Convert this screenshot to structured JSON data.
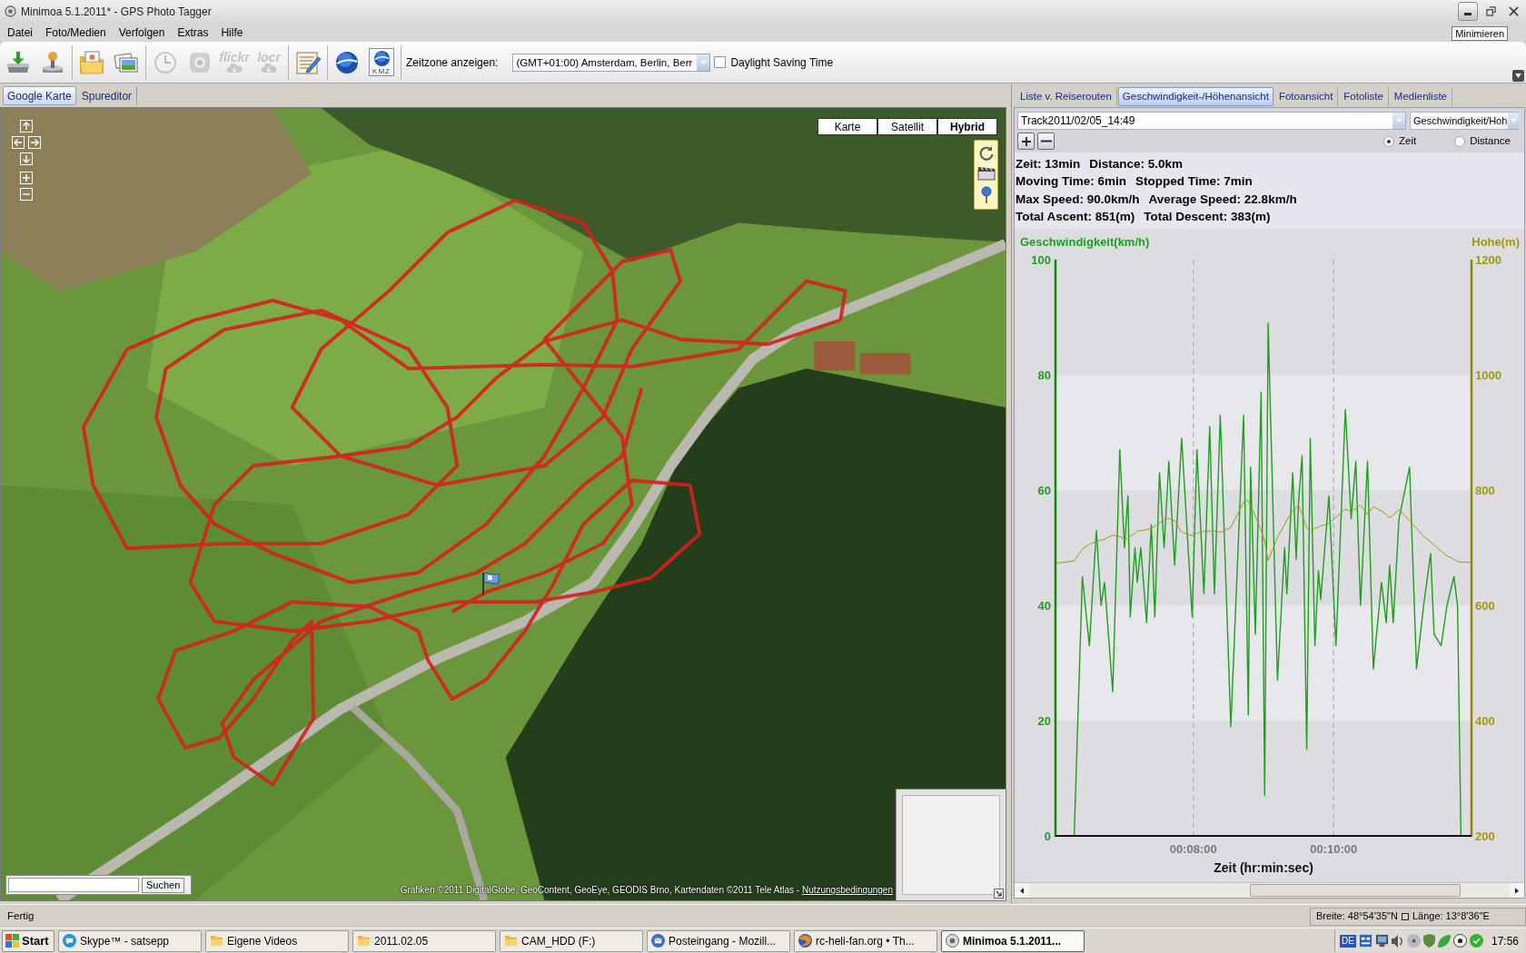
{
  "window": {
    "title": "Minimoa 5.1.2011* - GPS Photo Tagger",
    "controls": [
      {
        "kind": "minimize",
        "hovered": true
      },
      {
        "kind": "restore",
        "hovered": false
      },
      {
        "kind": "close",
        "hovered": false
      }
    ],
    "tooltip": "Minimieren"
  },
  "menu": [
    "Datei",
    "Foto/Medien",
    "Verfolgen",
    "Extras",
    "Hilfe"
  ],
  "toolbar": {
    "groups": [
      [
        {
          "kind": "icon",
          "disabled": false
        },
        {
          "kind": "icon",
          "disabled": false
        }
      ],
      [
        {
          "kind": "icon",
          "disabled": false
        },
        {
          "kind": "icon",
          "disabled": false
        }
      ],
      [
        {
          "kind": "icon",
          "disabled": true
        },
        {
          "kind": "icon",
          "disabled": true
        },
        {
          "kind": "wordmark",
          "label": "flickr",
          "disabled": true
        },
        {
          "kind": "wordmark",
          "label": "locr",
          "disabled": true
        }
      ],
      [
        {
          "kind": "icon",
          "disabled": false
        }
      ],
      [
        {
          "kind": "icon",
          "disabled": false
        },
        {
          "kind": "labeled-icon",
          "label": "KMZ",
          "disabled": false
        }
      ]
    ],
    "timezone_label": "Zeitzone anzeigen:",
    "timezone": "(GMT+01:00) Amsterdam, Berlin, Berr",
    "dst": {
      "label": "Daylight Saving Time",
      "checked": false
    }
  },
  "map_panel": {
    "tabs": [
      {
        "label": "Google Karte",
        "selected": true
      },
      {
        "label": "Spureditor",
        "selected": false
      }
    ],
    "map": {
      "types": [
        {
          "label": "Karte",
          "selected": false
        },
        {
          "label": "Satellit",
          "selected": false
        },
        {
          "label": "Hybrid",
          "selected": true
        }
      ],
      "search_button": "Suchen",
      "attribution": "Grafiken ©2011 DigitalGlobe, GeoContent, GeoEye, GEODIS Brno, Kartendaten ©2011 Tele Atlas -",
      "terms_link": "Nutzungsbedingungen"
    }
  },
  "right_panel": {
    "tabs": [
      {
        "label": "Liste v. Reiserouten",
        "selected": false
      },
      {
        "label": "Geschwindigkeit-/Höhenansicht",
        "selected": true
      },
      {
        "label": "Fotoansicht",
        "selected": false
      },
      {
        "label": "Fotoliste",
        "selected": false
      },
      {
        "label": "Medienliste",
        "selected": false
      }
    ],
    "track_select": "Track2011/02/05_14:49",
    "view_select": "Geschwindigkeit/Hoh",
    "axis_modes": [
      {
        "label": "Zeit",
        "selected": true
      },
      {
        "label": "Distance",
        "selected": false
      }
    ],
    "stats": [
      [
        "Zeit: 13min",
        "Distance: 5.0km"
      ],
      [
        "Moving Time: 6min",
        "Stopped Time: 7min"
      ],
      [
        "Max Speed: 90.0km/h",
        "Average Speed: 22.8km/h"
      ],
      [
        "Total Ascent: 851(m)",
        "Total Descent: 383(m)"
      ]
    ],
    "chart_data": {
      "type": "line",
      "xlabel": "Zeit (hr:min:sec)",
      "x": [
        362,
        378,
        385,
        391,
        397,
        401,
        404,
        411,
        417,
        421,
        424,
        426,
        430,
        432,
        435,
        440,
        444,
        447,
        451,
        455,
        459,
        464,
        470,
        479,
        483,
        489,
        494,
        498,
        503,
        512,
        523,
        527,
        529,
        533,
        538,
        541,
        544,
        552,
        558,
        560,
        565,
        568,
        570,
        573,
        577,
        580,
        584,
        587,
        589,
        596,
        602,
        610,
        615,
        619,
        623,
        629,
        634,
        641,
        645,
        648,
        651,
        656,
        665,
        671,
        677,
        683,
        686,
        692,
        697,
        703,
        706,
        709,
        718
      ],
      "xlim": [
        362,
        718
      ],
      "xticks": [
        {
          "value": 480,
          "label": "00:08:00"
        },
        {
          "value": 600,
          "label": "00:10:00"
        }
      ],
      "ylim": [
        0,
        100
      ],
      "yticks": [
        0,
        20,
        40,
        60,
        80,
        100
      ],
      "y2lim": [
        200,
        1200
      ],
      "y2ticks": [
        200,
        400,
        600,
        800,
        1000,
        1200
      ],
      "series": [
        {
          "name": "Geschwindigkeit(km/h)",
          "color": "#1f9e1f",
          "values": [
            0,
            0,
            45,
            33,
            53,
            40,
            44,
            25,
            67,
            50,
            59,
            38,
            50,
            44,
            50,
            37,
            54,
            38,
            63,
            50,
            65,
            47,
            69,
            38,
            67,
            42,
            71,
            42,
            73,
            19,
            73,
            21,
            64,
            35,
            77,
            7,
            89,
            27,
            50,
            42,
            63,
            48,
            58,
            66,
            15,
            69,
            33,
            46,
            41,
            59,
            33,
            74,
            55,
            65,
            40,
            65,
            29,
            44,
            37,
            47,
            37,
            55,
            64,
            29,
            40,
            49,
            35,
            33,
            40,
            45,
            40,
            0,
            0
          ]
        },
        {
          "name": "Hohe(m)",
          "color": "#a09a12",
          "axis": "y2",
          "values": [
            673,
            677,
            698,
            706,
            711,
            713,
            715,
            722,
            719,
            716,
            715,
            720,
            725,
            729,
            730,
            731,
            734,
            737,
            743,
            748,
            751,
            747,
            727,
            721,
            725,
            729,
            729,
            729,
            727,
            735,
            779,
            782,
            772,
            755,
            730,
            712,
            678,
            718,
            740,
            748,
            764,
            769,
            774,
            758,
            734,
            728,
            733,
            736,
            738,
            742,
            753,
            767,
            763,
            768,
            774,
            758,
            771,
            764,
            758,
            752,
            757,
            766,
            747,
            733,
            720,
            710,
            705,
            694,
            686,
            680,
            676,
            675,
            675
          ]
        }
      ]
    }
  },
  "status_bar": {
    "text": "Fertig",
    "latitude": "Breite: 48°54'35\"N",
    "longitude": "Länge: 13°8'36\"E"
  },
  "taskbar": {
    "start": "Start",
    "tasks": [
      {
        "label": "Skype™ - satsepp",
        "selected": false
      },
      {
        "label": "Eigene Videos",
        "selected": false
      },
      {
        "label": "2011.02.05",
        "selected": false
      },
      {
        "label": "CAM_HDD (F:)",
        "selected": false
      },
      {
        "label": "Posteingang - Mozill...",
        "selected": false
      },
      {
        "label": "rc-heli-fan.org • Th...",
        "selected": false
      },
      {
        "label": "Minimoa 5.1.2011...",
        "selected": true
      }
    ],
    "language": "DE",
    "clock": "17:56"
  }
}
